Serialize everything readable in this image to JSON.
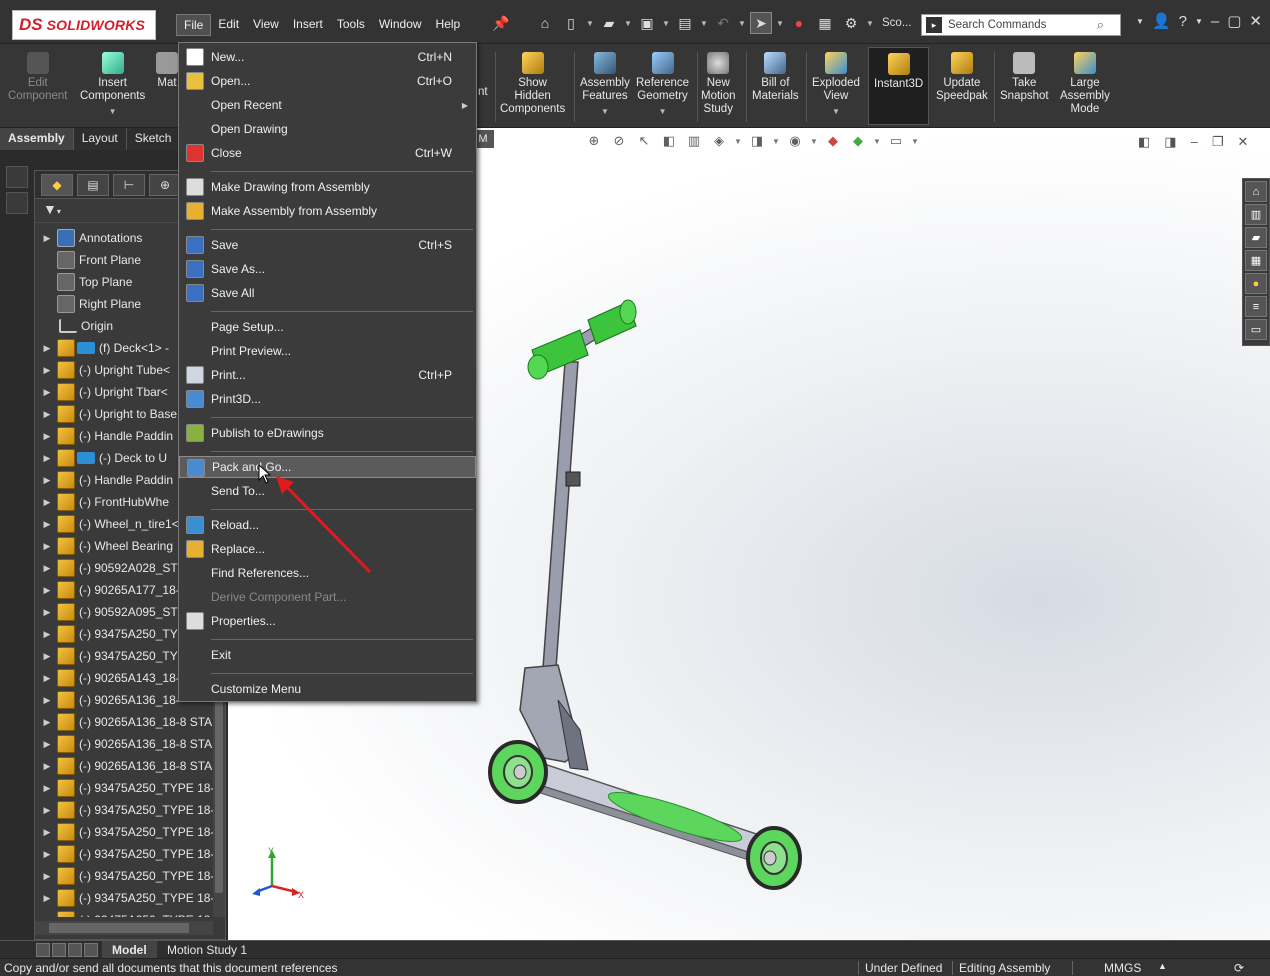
{
  "app": {
    "logo_mark": "DS",
    "logo_text": "SOLIDWORKS"
  },
  "menubar": [
    "File",
    "Edit",
    "View",
    "Insert",
    "Tools",
    "Window",
    "Help"
  ],
  "quickbar": {
    "scope_label": "Sco...",
    "search_placeholder": "Search Commands"
  },
  "command_manager": [
    {
      "label": "Edit\nComponent",
      "disabled": true
    },
    {
      "label": "Insert\nComponents"
    },
    {
      "label": "Mat"
    },
    {
      "label": "nt"
    },
    {
      "label": "Show\nHidden\nComponents"
    },
    {
      "label": "Assembly\nFeatures"
    },
    {
      "label": "Reference\nGeometry"
    },
    {
      "label": "New\nMotion\nStudy"
    },
    {
      "label": "Bill of\nMaterials"
    },
    {
      "label": "Exploded\nView"
    },
    {
      "label": "Instant3D"
    },
    {
      "label": "Update\nSpeedpak"
    },
    {
      "label": "Take\nSnapshot"
    },
    {
      "label": "Large\nAssembly\nMode"
    }
  ],
  "cm_tabs": [
    "Assembly",
    "Layout",
    "Sketch"
  ],
  "cm_extra": "M",
  "feature_tree": [
    {
      "label": "Annotations",
      "icon": "annot",
      "expand": true
    },
    {
      "label": "Front Plane",
      "icon": "plane",
      "expand": false
    },
    {
      "label": "Top Plane",
      "icon": "plane",
      "expand": false
    },
    {
      "label": "Right Plane",
      "icon": "plane",
      "expand": false
    },
    {
      "label": "Origin",
      "icon": "origin",
      "expand": false
    },
    {
      "label": "(f) Deck<1> -",
      "icon": "part",
      "cap": true,
      "expand": true
    },
    {
      "label": "(-) Upright Tube<",
      "icon": "part",
      "expand": true
    },
    {
      "label": "(-) Upright Tbar<",
      "icon": "part",
      "expand": true
    },
    {
      "label": "(-) Upright to Base",
      "icon": "part",
      "expand": true
    },
    {
      "label": "(-) Handle Paddin",
      "icon": "part",
      "expand": true
    },
    {
      "label": "(-) Deck to U",
      "icon": "part",
      "cap": true,
      "expand": true
    },
    {
      "label": "(-) Handle Paddin",
      "icon": "part",
      "expand": true
    },
    {
      "label": "(-) FrontHubWhe",
      "icon": "part",
      "expand": true
    },
    {
      "label": "(-) Wheel_n_tire1<",
      "icon": "part",
      "expand": true
    },
    {
      "label": "(-) Wheel Bearing",
      "icon": "part",
      "expand": true
    },
    {
      "label": "(-) 90592A028_STE",
      "icon": "part",
      "expand": true
    },
    {
      "label": "(-) 90265A177_18-",
      "icon": "part",
      "expand": true
    },
    {
      "label": "(-) 90592A095_STE",
      "icon": "part",
      "expand": true
    },
    {
      "label": "(-) 93475A250_TYP",
      "icon": "part",
      "expand": true
    },
    {
      "label": "(-) 93475A250_TYP",
      "icon": "part",
      "expand": true
    },
    {
      "label": "(-) 90265A143_18-",
      "icon": "part",
      "expand": true
    },
    {
      "label": "(-) 90265A136_18-",
      "icon": "part",
      "expand": true
    },
    {
      "label": "(-) 90265A136_18-8 STAI",
      "icon": "part",
      "expand": true
    },
    {
      "label": "(-) 90265A136_18-8 STAI",
      "icon": "part",
      "expand": true
    },
    {
      "label": "(-) 90265A136_18-8 STAI",
      "icon": "part",
      "expand": true
    },
    {
      "label": "(-) 93475A250_TYPE 18-8",
      "icon": "part",
      "expand": true
    },
    {
      "label": "(-) 93475A250_TYPE 18-8",
      "icon": "part",
      "expand": true
    },
    {
      "label": "(-) 93475A250_TYPE 18-8",
      "icon": "part",
      "expand": true
    },
    {
      "label": "(-) 93475A250_TYPE 18-8",
      "icon": "part",
      "expand": true
    },
    {
      "label": "(-) 93475A250_TYPE 18-8",
      "icon": "part",
      "expand": true
    },
    {
      "label": "(-) 93475A250_TYPE 18-8",
      "icon": "part",
      "expand": true
    },
    {
      "label": "(-) 93475A250_TYPE 18-8",
      "icon": "part",
      "expand": true
    }
  ],
  "file_menu": [
    {
      "label": "New...",
      "shortcut": "Ctrl+N",
      "icon": "#ffffff"
    },
    {
      "label": "Open...",
      "shortcut": "Ctrl+O",
      "icon": "#e8c040"
    },
    {
      "label": "Open Recent",
      "submenu": true
    },
    {
      "label": "Open Drawing"
    },
    {
      "label": "Close",
      "shortcut": "Ctrl+W",
      "icon": "#d33"
    },
    {
      "sep": true
    },
    {
      "label": "Make Drawing from Assembly",
      "icon": "#ddd"
    },
    {
      "label": "Make Assembly from Assembly",
      "icon": "#e8b030"
    },
    {
      "sep": true
    },
    {
      "label": "Save",
      "shortcut": "Ctrl+S",
      "icon": "#3a6fc2"
    },
    {
      "label": "Save As...",
      "icon": "#3a6fc2"
    },
    {
      "label": "Save All",
      "icon": "#3a6fc2"
    },
    {
      "sep": true
    },
    {
      "label": "Page Setup..."
    },
    {
      "label": "Print Preview..."
    },
    {
      "label": "Print...",
      "shortcut": "Ctrl+P",
      "icon": "#cfd6e0"
    },
    {
      "label": "Print3D...",
      "icon": "#4a8ad0"
    },
    {
      "sep": true
    },
    {
      "label": "Publish to eDrawings",
      "icon": "#8ab040"
    },
    {
      "sep": true
    },
    {
      "label": "Pack and Go...",
      "icon": "#4a8ad0",
      "highlight": true
    },
    {
      "label": "Send To..."
    },
    {
      "sep": true
    },
    {
      "label": "Reload...",
      "icon": "#3a8fd0"
    },
    {
      "label": "Replace...",
      "icon": "#e8b030"
    },
    {
      "label": "Find References..."
    },
    {
      "label": "Derive Component Part...",
      "disabled": true
    },
    {
      "label": "Properties...",
      "icon": "#ddd"
    },
    {
      "sep": true
    },
    {
      "label": "Exit"
    },
    {
      "sep": true
    },
    {
      "label": "Customize Menu"
    }
  ],
  "bottom_tabs": [
    "Model",
    "Motion Study 1"
  ],
  "status": {
    "message": "Copy and/or send all documents that this document references",
    "state": "Under Defined",
    "mode": "Editing Assembly",
    "units": "MMGS"
  },
  "triad": {
    "x": "X",
    "y": "Y"
  },
  "colors": {
    "accent_green": "#3cc43c",
    "menu_bg": "#3b3b3b",
    "highlight": "#5b5b5b"
  }
}
